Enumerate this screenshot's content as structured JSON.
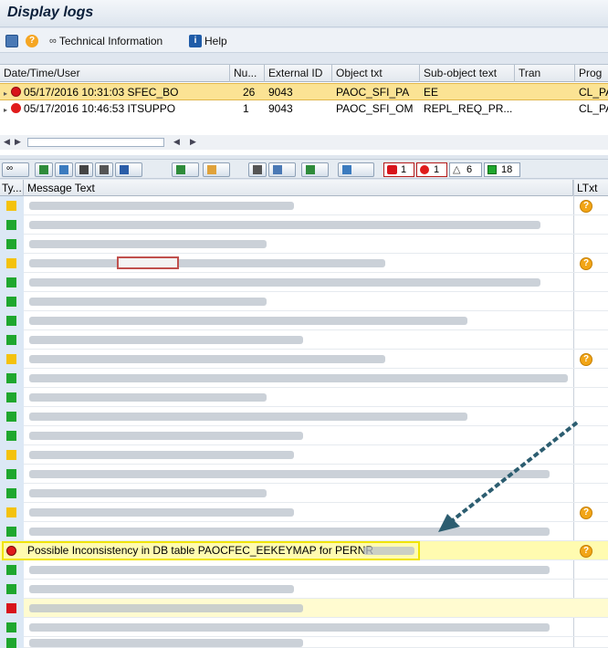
{
  "window": {
    "title": "Display logs"
  },
  "app_toolbar": {
    "technical_info_label": "Technical Information",
    "help_label": "Help"
  },
  "log_header_table": {
    "columns": [
      "Date/Time/User",
      "Nu...",
      "External ID",
      "Object txt",
      "Sub-object text",
      "Tran",
      "Prog"
    ],
    "rows": [
      {
        "datetime_user": "05/17/2016  10:31:03  SFEC_BO",
        "number": "26",
        "external_id": "9043",
        "object_txt": "PAOC_SFI_PA",
        "subobject_txt": "EE",
        "tran": "",
        "prog": "CL_PA",
        "selected": true
      },
      {
        "datetime_user": "05/17/2016  10:46:53  ITSUPPO",
        "number": "1",
        "external_id": "9043",
        "object_txt": "PAOC_SFI_OM",
        "subobject_txt": "REPL_REQ_PR...",
        "tran": "",
        "prog": "CL_PA",
        "selected": false
      }
    ]
  },
  "message_toolbar": {
    "stop_count": "1",
    "error_count": "1",
    "warning_count": "6",
    "success_count": "18"
  },
  "message_table": {
    "columns": {
      "type": "Ty...",
      "text": "Message Text",
      "ltxt": "LTxt"
    },
    "highlighted_message": "Possible Inconsistency in DB table PAOCFEC_EEKEYMAP for PERNR"
  },
  "colors": {
    "selection": "#fbe394",
    "highlight": "#fffbb0",
    "success": "#1fa72e",
    "warning": "#f4c20d",
    "error": "#d8141b"
  }
}
